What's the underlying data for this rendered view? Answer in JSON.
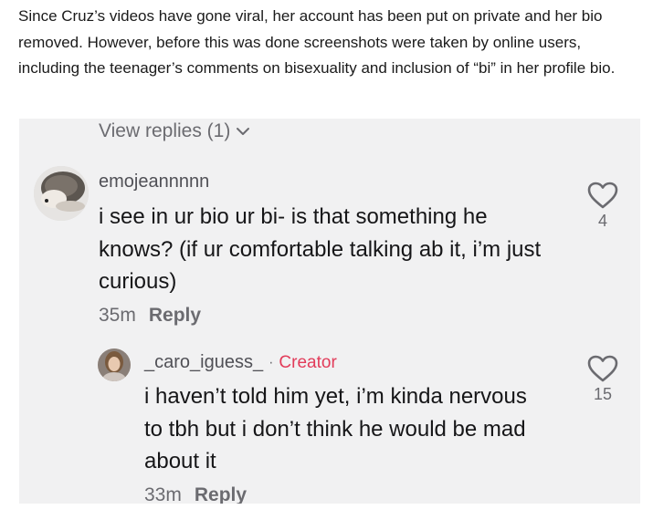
{
  "article": {
    "paragraph": "Since Cruz’s videos have gone viral, her account has been put on private and her bio removed. However, before this was done screenshots were taken by online users, including the teenager’s comments on bisexuality and inclusion of “bi” in her profile bio."
  },
  "screenshot": {
    "view_replies": "View replies (1)",
    "comments": [
      {
        "username": "emojeannnnn",
        "text": "i see in ur bio ur bi- is that something he knows? (if ur comfortable talking ab it, i’m just curious)",
        "time": "35m",
        "reply": "Reply",
        "likes": "4",
        "avatar_icon": "hedgehog-avatar"
      },
      {
        "username": "_caro_iguess_",
        "badge_separator": "·",
        "badge": "Creator",
        "text": "i haven’t told him yet, i’m kinda nervous to tbh but i don’t think he would be mad about it",
        "time": "33m",
        "reply": "Reply",
        "likes": "15",
        "avatar_icon": "user-avatar"
      }
    ],
    "colors": {
      "creator": "#e23c5a",
      "muted": "#6b6b70",
      "background": "#f1f1f2"
    }
  }
}
